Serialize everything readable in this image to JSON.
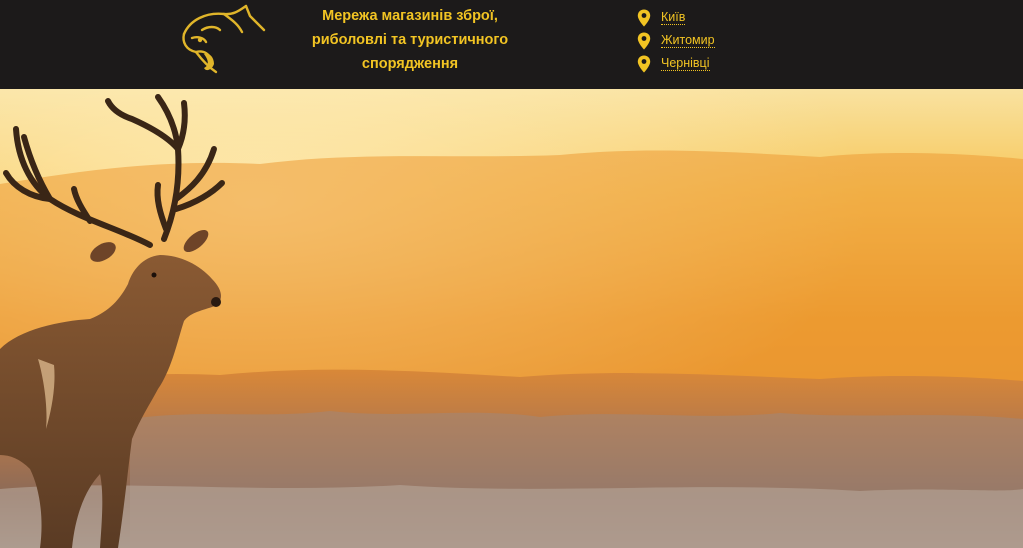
{
  "brand": {
    "logo_icon": "cougar-head-logo",
    "tagline_lines": [
      "Мережа магазинів зброї,",
      "риболовлі та туристичного",
      "спорядження"
    ]
  },
  "cities": [
    {
      "icon": "map-pin-icon",
      "label": "Київ"
    },
    {
      "icon": "map-pin-icon",
      "label": "Житомир"
    },
    {
      "icon": "map-pin-icon",
      "label": "Чернівці"
    }
  ],
  "hero": {
    "image": "deer-at-sunrise-photo"
  },
  "colors": {
    "header_bg": "#1c1a1a",
    "accent": "#f2c423",
    "sky": "#f7c75a",
    "field": "#e8902a"
  }
}
